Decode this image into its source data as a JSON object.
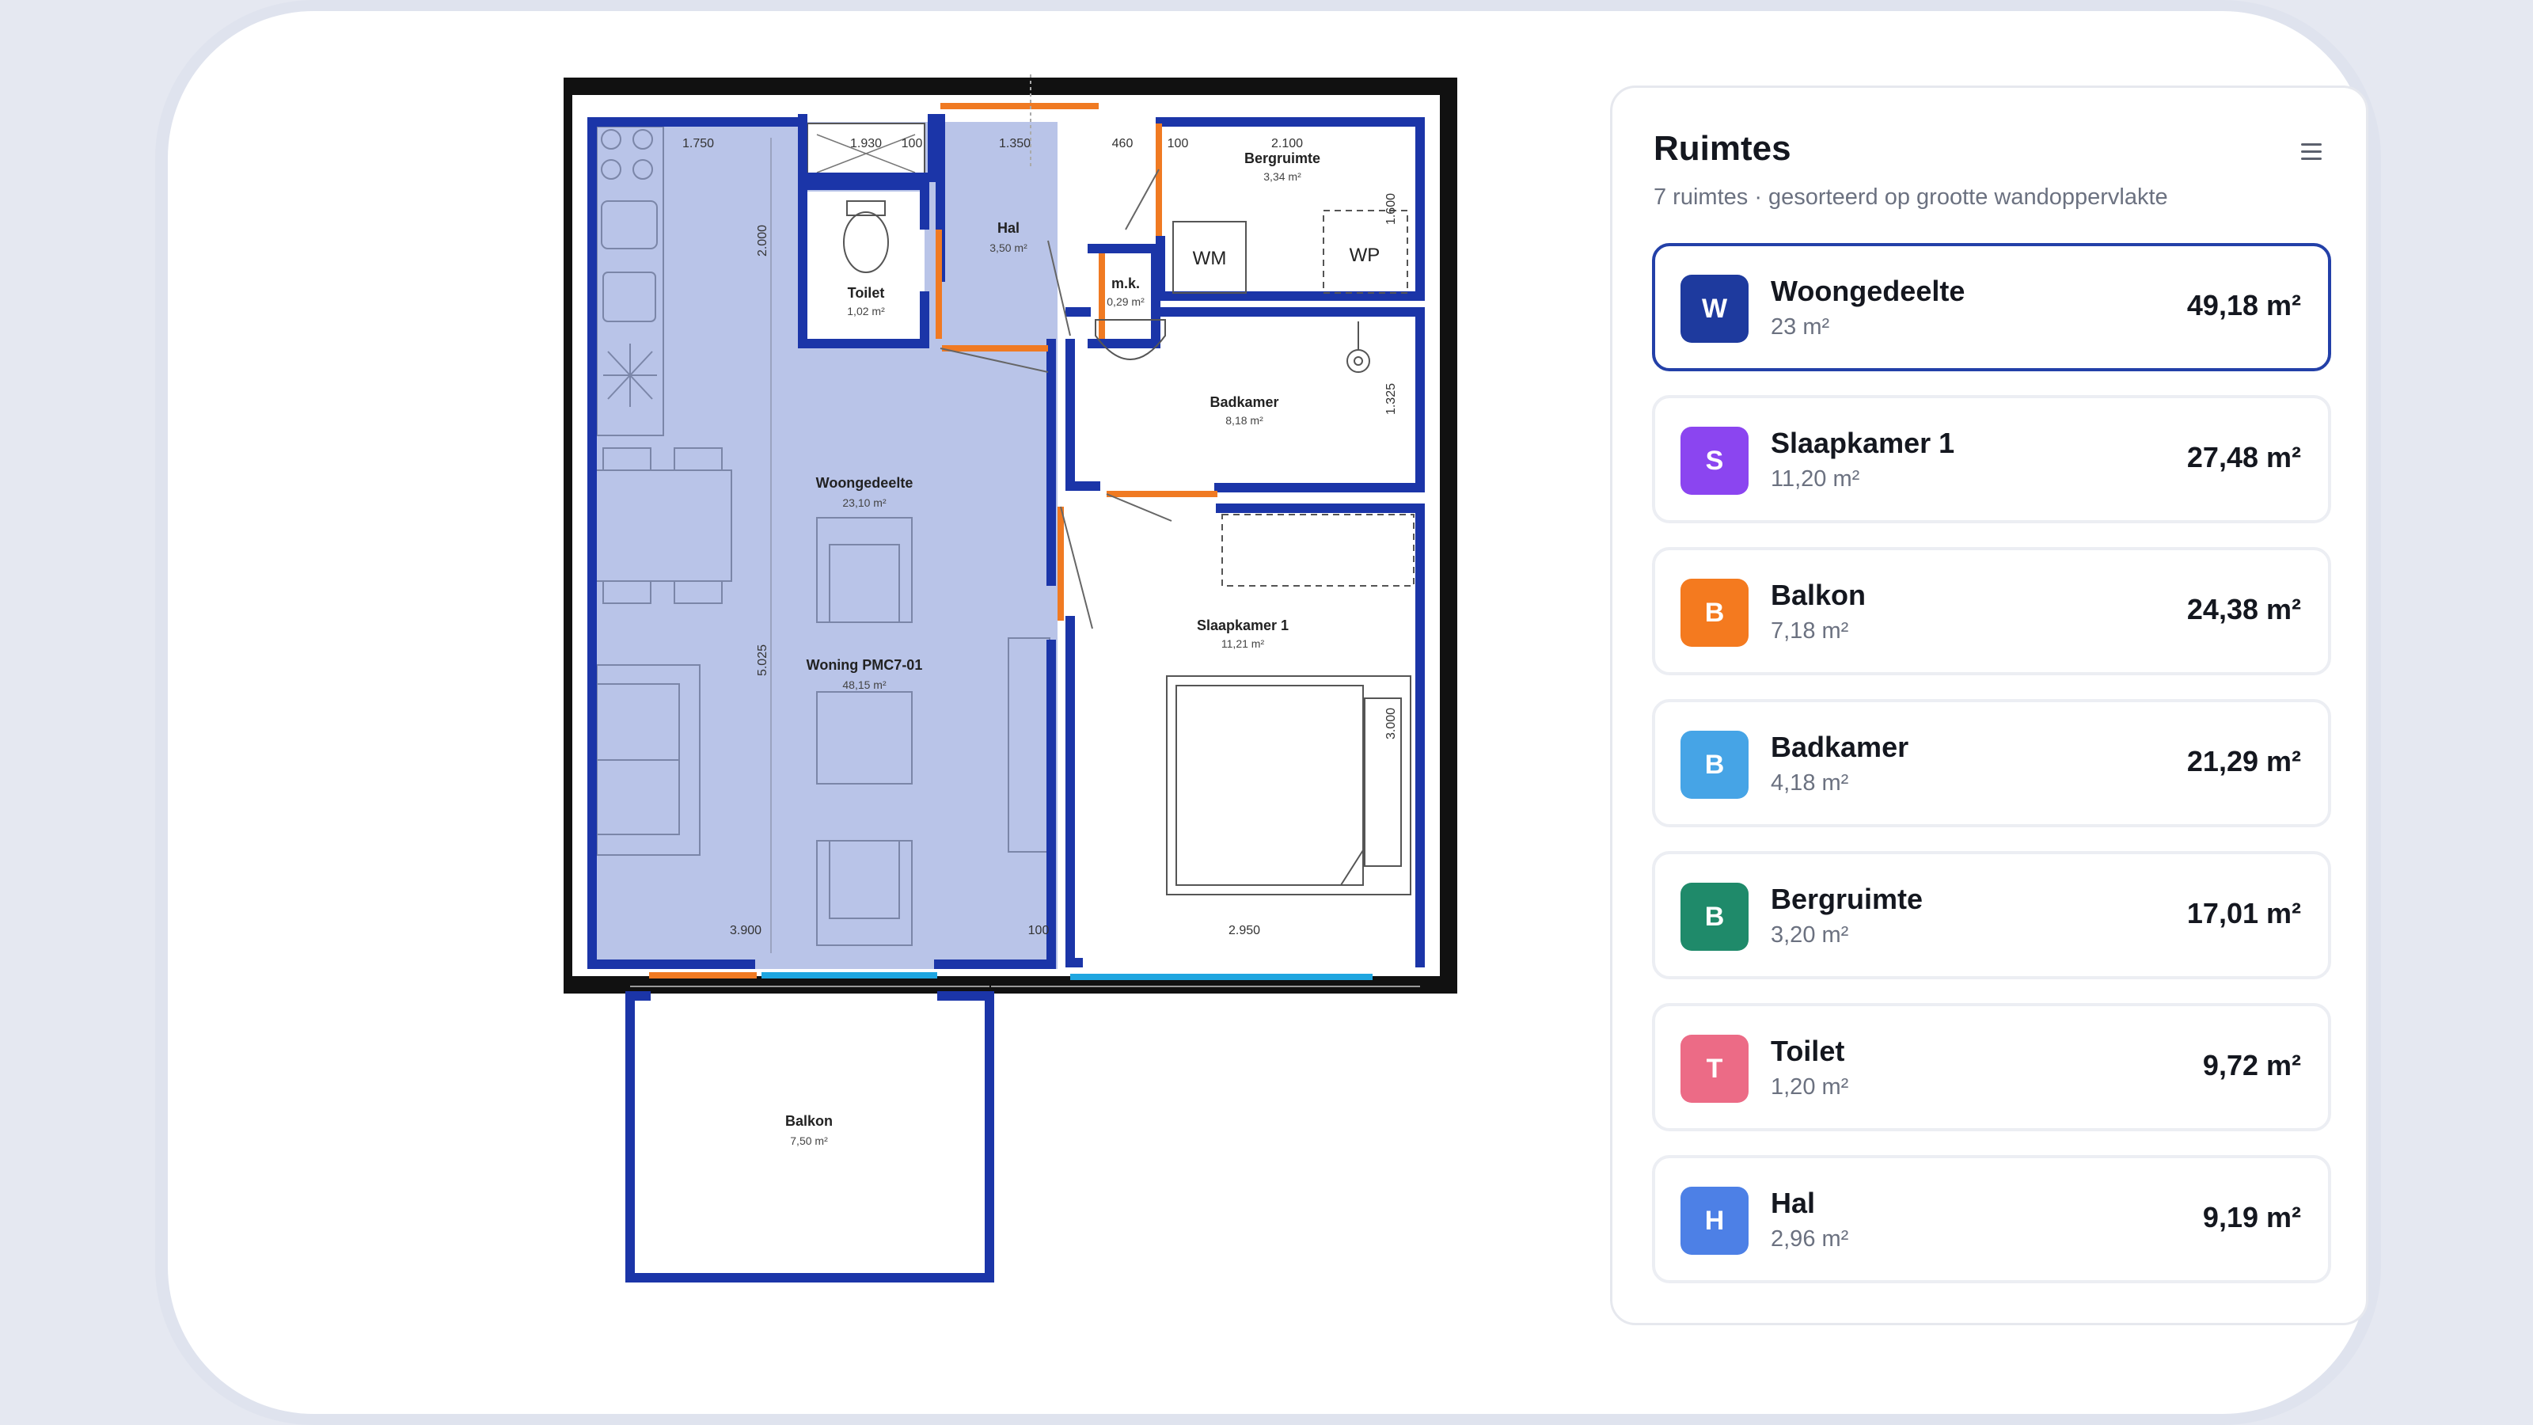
{
  "panel": {
    "title": "Ruimtes",
    "subtitle": "7 ruimtes · gesorteerd op grootte wandoppervlakte",
    "menu_icon": "hamburger-menu-icon"
  },
  "rooms": [
    {
      "letter": "W",
      "name": "Woongedeelte",
      "area": "23 m²",
      "value": "49,18 m²",
      "color": "#1e3a9e",
      "active": true
    },
    {
      "letter": "S",
      "name": "Slaapkamer 1",
      "area": "11,20 m²",
      "value": "27,48 m²",
      "color": "#8b45f0",
      "active": false
    },
    {
      "letter": "B",
      "name": "Balkon",
      "area": "7,18 m²",
      "value": "24,38 m²",
      "color": "#f47a1f",
      "active": false
    },
    {
      "letter": "B",
      "name": "Badkamer",
      "area": "4,18 m²",
      "value": "21,29 m²",
      "color": "#46a4e6",
      "active": false
    },
    {
      "letter": "B",
      "name": "Bergruimte",
      "area": "3,20 m²",
      "value": "17,01 m²",
      "color": "#1f8a6a",
      "active": false
    },
    {
      "letter": "T",
      "name": "Toilet",
      "area": "1,20 m²",
      "value": "9,72 m²",
      "color": "#ec6b86",
      "active": false
    },
    {
      "letter": "H",
      "name": "Hal",
      "area": "2,96 m²",
      "value": "9,19 m²",
      "color": "#4d80e6",
      "active": false
    }
  ],
  "plan": {
    "labels": {
      "woning": "Woning PMC7-01",
      "woning_area": "48,15 m²",
      "woongedeelte": "Woongedeelte",
      "woongedeelte_area": "23,10 m²",
      "hal": "Hal",
      "hal_area": "3,50 m²",
      "toilet": "Toilet",
      "toilet_area": "1,02 m²",
      "mk": "m.k.",
      "mk_area": "0,29 m²",
      "bergruimte": "Bergruimte",
      "bergruimte_area": "3,34 m²",
      "wm": "WM",
      "wp": "WP",
      "badkamer": "Badkamer",
      "badkamer_area": "8,18 m²",
      "slaapkamer": "Slaapkamer 1",
      "slaapkamer_area": "11,21 m²",
      "balkon": "Balkon",
      "balkon_area": "7,50 m²"
    },
    "dims": {
      "d1750": "1.750",
      "d1930": "1.930",
      "d100a": "100",
      "d1350": "1.350",
      "d460": "460",
      "d100b": "100",
      "d2100": "2.100",
      "d2000": "2.000",
      "d1600": "1.600",
      "d1325": "1.325",
      "d5025": "5.025",
      "d3000": "3.000",
      "d3900": "3.900",
      "d100c": "100",
      "d2950": "2.950"
    },
    "colors": {
      "wall": "#1b35a8",
      "door": "#f07a22",
      "window": "#1fa6e0",
      "selected_fill": "#b9c4e8"
    }
  }
}
